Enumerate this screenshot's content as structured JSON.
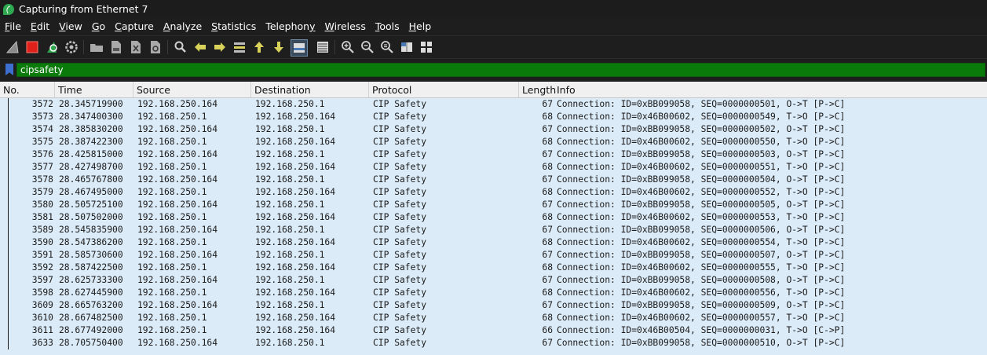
{
  "window": {
    "title": "Capturing from Ethernet 7"
  },
  "menu": [
    {
      "label": "File",
      "mnemonic": "F"
    },
    {
      "label": "Edit",
      "mnemonic": "E"
    },
    {
      "label": "View",
      "mnemonic": "V"
    },
    {
      "label": "Go",
      "mnemonic": "G"
    },
    {
      "label": "Capture",
      "mnemonic": "C"
    },
    {
      "label": "Analyze",
      "mnemonic": "A"
    },
    {
      "label": "Statistics",
      "mnemonic": "S"
    },
    {
      "label": "Telephony",
      "mnemonic": "y"
    },
    {
      "label": "Wireless",
      "mnemonic": "W"
    },
    {
      "label": "Tools",
      "mnemonic": "T"
    },
    {
      "label": "Help",
      "mnemonic": "H"
    }
  ],
  "toolbar": {
    "icons": [
      "shark-fin-start-icon",
      "stop-capture-icon",
      "restart-capture-icon",
      "capture-options-gear-icon",
      "open-folder-icon",
      "save-file-icon",
      "close-file-icon",
      "reload-file-icon",
      "find-packet-icon",
      "go-back-arrow-icon",
      "go-forward-arrow-icon",
      "go-to-packet-icon",
      "go-to-first-packet-icon",
      "go-to-last-packet-icon",
      "auto-scroll-icon",
      "colorize-icon",
      "zoom-in-icon",
      "zoom-out-icon",
      "normal-size-icon",
      "resize-columns-icon",
      "layout-icon"
    ],
    "accent_stop": "#e0201a",
    "accent_restart": "#2fa84f"
  },
  "filter": {
    "value": "cipsafety",
    "bg_color": "#0a7a0a"
  },
  "columns": [
    "No.",
    "Time",
    "Source",
    "Destination",
    "Protocol",
    "Length",
    "Info"
  ],
  "row_bg_color": "#dcebf8",
  "rows": [
    {
      "no": "3572",
      "time": "28.345719900",
      "src": "192.168.250.164",
      "dst": "192.168.250.1",
      "proto": "CIP Safety",
      "len": "67",
      "info": "Connection: ID=0xBB099058, SEQ=0000000501, O->T [P->C]"
    },
    {
      "no": "3573",
      "time": "28.347400300",
      "src": "192.168.250.1",
      "dst": "192.168.250.164",
      "proto": "CIP Safety",
      "len": "68",
      "info": "Connection: ID=0x46B00602, SEQ=0000000549, T->O [P->C]"
    },
    {
      "no": "3574",
      "time": "28.385830200",
      "src": "192.168.250.164",
      "dst": "192.168.250.1",
      "proto": "CIP Safety",
      "len": "67",
      "info": "Connection: ID=0xBB099058, SEQ=0000000502, O->T [P->C]"
    },
    {
      "no": "3575",
      "time": "28.387422300",
      "src": "192.168.250.1",
      "dst": "192.168.250.164",
      "proto": "CIP Safety",
      "len": "68",
      "info": "Connection: ID=0x46B00602, SEQ=0000000550, T->O [P->C]"
    },
    {
      "no": "3576",
      "time": "28.425815000",
      "src": "192.168.250.164",
      "dst": "192.168.250.1",
      "proto": "CIP Safety",
      "len": "67",
      "info": "Connection: ID=0xBB099058, SEQ=0000000503, O->T [P->C]"
    },
    {
      "no": "3577",
      "time": "28.427498700",
      "src": "192.168.250.1",
      "dst": "192.168.250.164",
      "proto": "CIP Safety",
      "len": "68",
      "info": "Connection: ID=0x46B00602, SEQ=0000000551, T->O [P->C]"
    },
    {
      "no": "3578",
      "time": "28.465767800",
      "src": "192.168.250.164",
      "dst": "192.168.250.1",
      "proto": "CIP Safety",
      "len": "67",
      "info": "Connection: ID=0xBB099058, SEQ=0000000504, O->T [P->C]"
    },
    {
      "no": "3579",
      "time": "28.467495000",
      "src": "192.168.250.1",
      "dst": "192.168.250.164",
      "proto": "CIP Safety",
      "len": "68",
      "info": "Connection: ID=0x46B00602, SEQ=0000000552, T->O [P->C]"
    },
    {
      "no": "3580",
      "time": "28.505725100",
      "src": "192.168.250.164",
      "dst": "192.168.250.1",
      "proto": "CIP Safety",
      "len": "67",
      "info": "Connection: ID=0xBB099058, SEQ=0000000505, O->T [P->C]"
    },
    {
      "no": "3581",
      "time": "28.507502000",
      "src": "192.168.250.1",
      "dst": "192.168.250.164",
      "proto": "CIP Safety",
      "len": "68",
      "info": "Connection: ID=0x46B00602, SEQ=0000000553, T->O [P->C]"
    },
    {
      "no": "3589",
      "time": "28.545835900",
      "src": "192.168.250.164",
      "dst": "192.168.250.1",
      "proto": "CIP Safety",
      "len": "67",
      "info": "Connection: ID=0xBB099058, SEQ=0000000506, O->T [P->C]"
    },
    {
      "no": "3590",
      "time": "28.547386200",
      "src": "192.168.250.1",
      "dst": "192.168.250.164",
      "proto": "CIP Safety",
      "len": "68",
      "info": "Connection: ID=0x46B00602, SEQ=0000000554, T->O [P->C]"
    },
    {
      "no": "3591",
      "time": "28.585730600",
      "src": "192.168.250.164",
      "dst": "192.168.250.1",
      "proto": "CIP Safety",
      "len": "67",
      "info": "Connection: ID=0xBB099058, SEQ=0000000507, O->T [P->C]"
    },
    {
      "no": "3592",
      "time": "28.587422500",
      "src": "192.168.250.1",
      "dst": "192.168.250.164",
      "proto": "CIP Safety",
      "len": "68",
      "info": "Connection: ID=0x46B00602, SEQ=0000000555, T->O [P->C]"
    },
    {
      "no": "3597",
      "time": "28.625733300",
      "src": "192.168.250.164",
      "dst": "192.168.250.1",
      "proto": "CIP Safety",
      "len": "67",
      "info": "Connection: ID=0xBB099058, SEQ=0000000508, O->T [P->C]"
    },
    {
      "no": "3598",
      "time": "28.627445900",
      "src": "192.168.250.1",
      "dst": "192.168.250.164",
      "proto": "CIP Safety",
      "len": "68",
      "info": "Connection: ID=0x46B00602, SEQ=0000000556, T->O [P->C]"
    },
    {
      "no": "3609",
      "time": "28.665763200",
      "src": "192.168.250.164",
      "dst": "192.168.250.1",
      "proto": "CIP Safety",
      "len": "67",
      "info": "Connection: ID=0xBB099058, SEQ=0000000509, O->T [P->C]"
    },
    {
      "no": "3610",
      "time": "28.667482500",
      "src": "192.168.250.1",
      "dst": "192.168.250.164",
      "proto": "CIP Safety",
      "len": "68",
      "info": "Connection: ID=0x46B00602, SEQ=0000000557, T->O [P->C]"
    },
    {
      "no": "3611",
      "time": "28.677492000",
      "src": "192.168.250.1",
      "dst": "192.168.250.164",
      "proto": "CIP Safety",
      "len": "66",
      "info": "Connection: ID=0x46B00504, SEQ=0000000031, T->O [C->P]"
    },
    {
      "no": "3633",
      "time": "28.705750400",
      "src": "192.168.250.164",
      "dst": "192.168.250.1",
      "proto": "CIP Safety",
      "len": "67",
      "info": "Connection: ID=0xBB099058, SEQ=0000000510, O->T [P->C]"
    }
  ]
}
